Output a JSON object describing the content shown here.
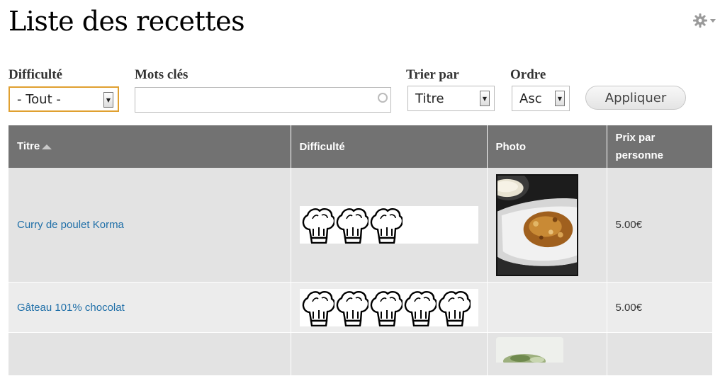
{
  "page": {
    "title": "Liste des recettes"
  },
  "filters": {
    "difficulte": {
      "label": "Difficulté",
      "value": "- Tout -"
    },
    "mots_cles": {
      "label": "Mots clés",
      "value": ""
    },
    "trier_par": {
      "label": "Trier par",
      "value": "Titre"
    },
    "ordre": {
      "label": "Ordre",
      "value": "Asc"
    },
    "apply_label": "Appliquer"
  },
  "table": {
    "headers": {
      "titre": "Titre",
      "difficulte": "Difficulté",
      "photo": "Photo",
      "prix": "Prix par personne"
    },
    "sort_direction": "ascending",
    "rows": [
      {
        "titre": "Curry de poulet Korma",
        "difficulty_hats": 3,
        "has_photo": true,
        "prix": "5.00€"
      },
      {
        "titre": "Gâteau 101% chocolat",
        "difficulty_hats": 5,
        "has_photo": false,
        "prix": "5.00€"
      },
      {
        "titre": "",
        "difficulty_hats": 0,
        "has_photo": true,
        "prix": ""
      }
    ]
  },
  "icons": {
    "settings": "gear-icon",
    "sort": "sort-asc-icon",
    "difficulty": "chef-hat-icon"
  },
  "colors": {
    "header_bg": "#727272",
    "link": "#1f6fa8",
    "focus_border": "#e0a030"
  }
}
